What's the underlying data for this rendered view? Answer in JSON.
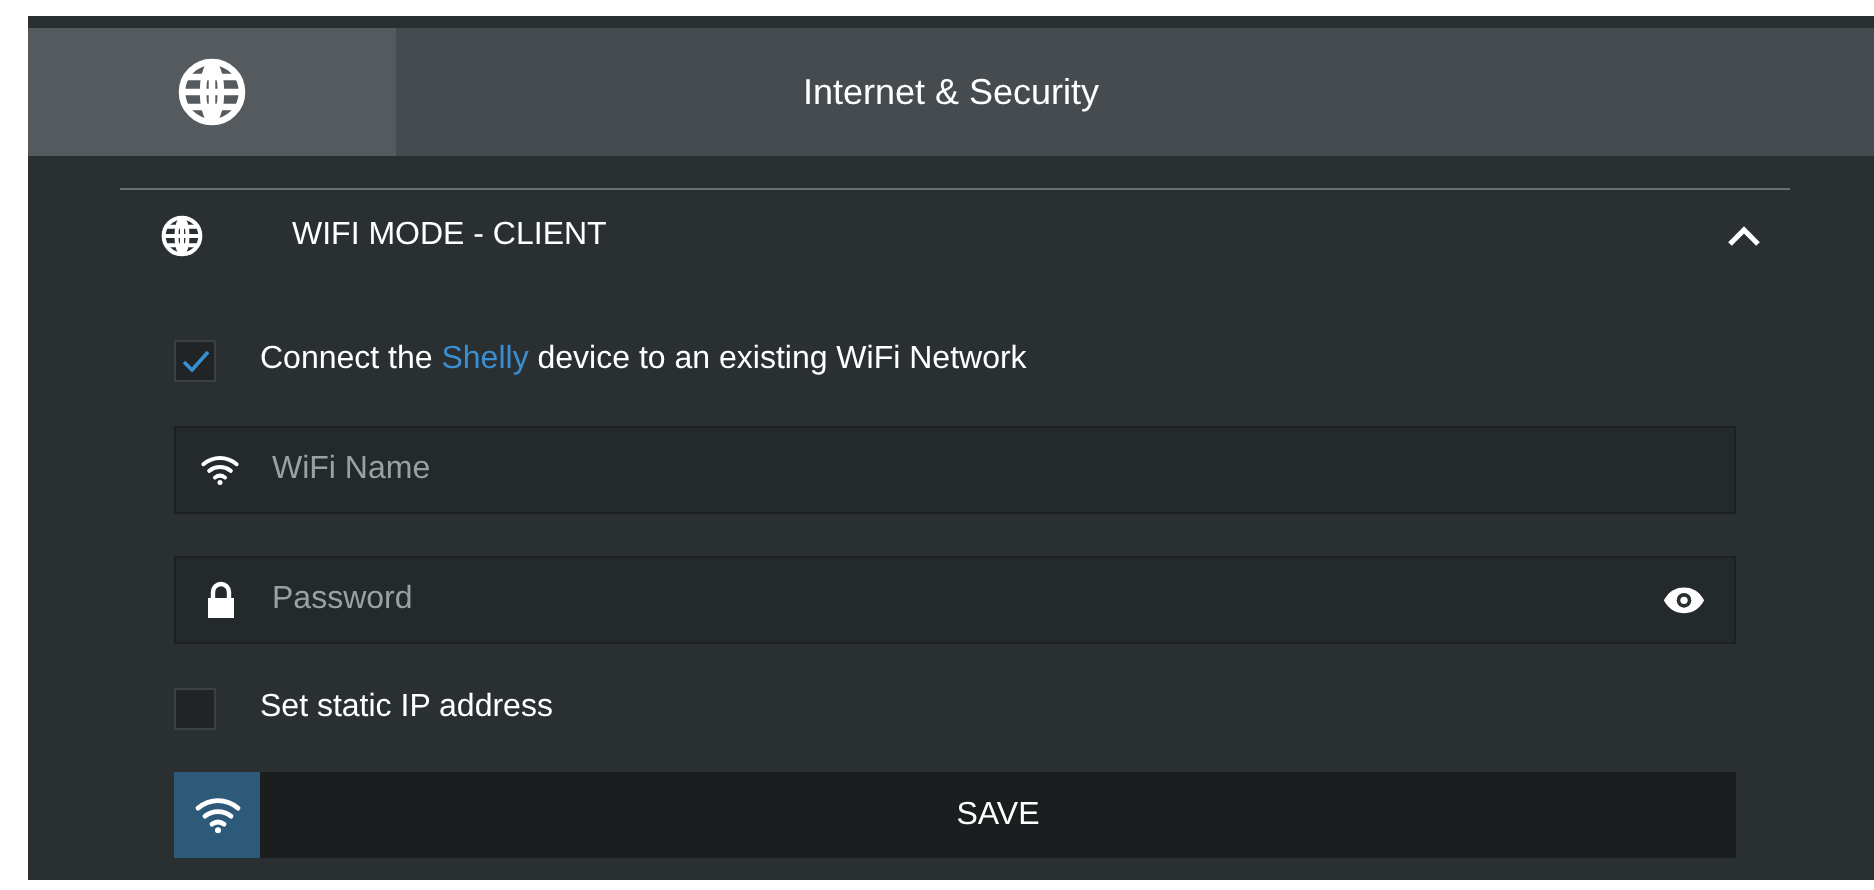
{
  "header": {
    "title": "Internet & Security"
  },
  "section": {
    "title": "WIFI MODE - CLIENT",
    "expanded": true,
    "options": [
      {
        "kind": "checkbox",
        "checked": true,
        "before": "Connect the",
        "link": "Shelly",
        "after": "device to an existing WiFi Network"
      },
      {
        "kind": "network-field",
        "placeholder": "WiFi Name"
      },
      {
        "kind": "password-field",
        "placeholder": "Password"
      },
      {
        "kind": "checkbox",
        "checked": false,
        "before": "Set static IP address"
      }
    ],
    "save_button": {
      "label": "SAVE"
    }
  }
}
